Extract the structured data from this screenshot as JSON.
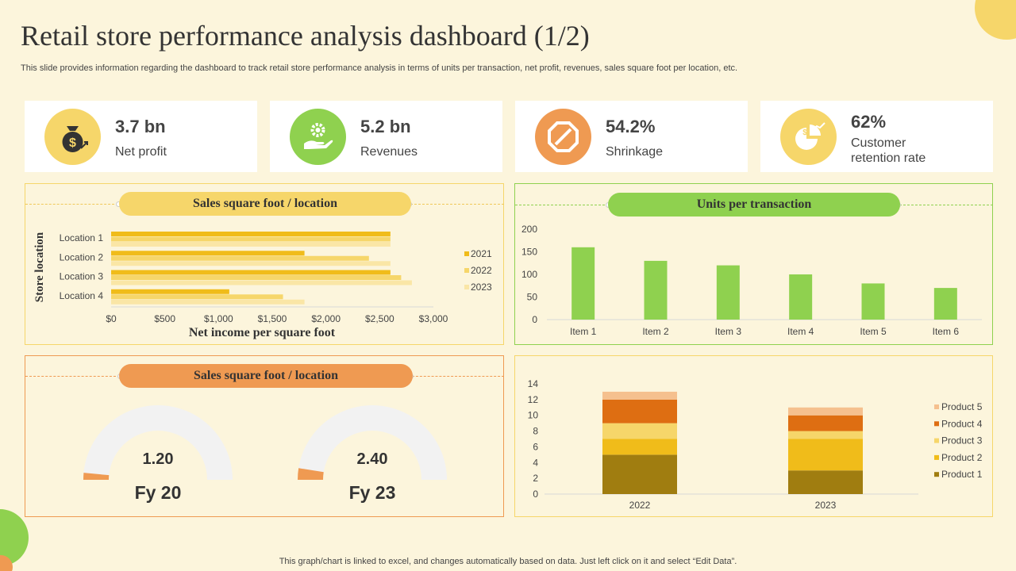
{
  "title": "Retail store performance analysis dashboard (1/2)",
  "subtitle": "This slide provides information regarding the dashboard to track retail store performance analysis in terms of units per transaction, net profit, revenues, sales square foot per location, etc.",
  "kpis": [
    {
      "value": "3.7 bn",
      "label": "Net profit",
      "icon": "money-bag-icon",
      "color": "#f6d66a"
    },
    {
      "value": "5.2 bn",
      "label": "Revenues",
      "icon": "gear-hand-icon",
      "color": "#8fd14f"
    },
    {
      "value": "54.2%",
      "label": "Shrinkage",
      "icon": "octagon-icon",
      "color": "#ef9a52"
    },
    {
      "value": "62%",
      "label": "Customer retention rate",
      "icon": "pie-growth-icon",
      "color": "#f6d66a"
    }
  ],
  "panels": {
    "sales_sqft": {
      "title": "Sales square foot / location"
    },
    "units": {
      "title": "Units per transaction"
    },
    "gauges": {
      "title": "Sales square foot / location"
    }
  },
  "footer": "This graph/chart is linked to excel,  and changes automatically based on data. Just left click on it and select “Edit Data”.",
  "colors": {
    "yellow": "#f6d66a",
    "green": "#8fd14f",
    "orange": "#ef9a52",
    "background": "#fcf5dc"
  },
  "chart_data": [
    {
      "type": "bar",
      "orientation": "horizontal",
      "categories": [
        "Location 1",
        "Location 2",
        "Location 3",
        "Location 4"
      ],
      "series": [
        {
          "name": "2021",
          "values": [
            2600,
            1800,
            2600,
            1100
          ],
          "color": "#f0bc1a"
        },
        {
          "name": "2022",
          "values": [
            2600,
            2400,
            2700,
            1600
          ],
          "color": "#f6d66a"
        },
        {
          "name": "2023",
          "values": [
            2600,
            2600,
            2800,
            1800
          ],
          "color": "#fae6a6"
        }
      ],
      "xlabel": "Net income per square foot",
      "ylabel": "Store location",
      "xlim": [
        0,
        3000
      ],
      "xticks": [
        "$0",
        "$500",
        "$1,000",
        "$1,500",
        "$2,000",
        "$2,500",
        "$3,000"
      ],
      "legend": "right"
    },
    {
      "type": "bar",
      "categories": [
        "Item 1",
        "Item 2",
        "Item 3",
        "Item 4",
        "Item 5",
        "Item 6"
      ],
      "values": [
        160,
        130,
        120,
        100,
        80,
        70
      ],
      "ylim": [
        0,
        200
      ],
      "yticks": [
        "0",
        "50",
        "100",
        "150",
        "200"
      ],
      "color": "#8fd14f"
    },
    {
      "type": "gauge",
      "gauges": [
        {
          "value": "1.20",
          "label": "Fy 20",
          "fill": 0.03
        },
        {
          "value": "2.40",
          "label": "Fy 23",
          "fill": 0.05
        }
      ]
    },
    {
      "type": "bar",
      "stacked": true,
      "categories": [
        "2022",
        "2023"
      ],
      "series": [
        {
          "name": "Product 1",
          "values": [
            5,
            3
          ],
          "color": "#a07d10"
        },
        {
          "name": "Product 2",
          "values": [
            2,
            4
          ],
          "color": "#f0bc1a"
        },
        {
          "name": "Product 3",
          "values": [
            2,
            1
          ],
          "color": "#f6d66a"
        },
        {
          "name": "Product 4",
          "values": [
            3,
            2
          ],
          "color": "#de6e12"
        },
        {
          "name": "Product 5",
          "values": [
            1,
            1
          ],
          "color": "#f5c08e"
        }
      ],
      "ylim": [
        0,
        14
      ],
      "yticks": [
        "0",
        "2",
        "4",
        "6",
        "8",
        "10",
        "12",
        "14"
      ],
      "legend": "right"
    }
  ]
}
